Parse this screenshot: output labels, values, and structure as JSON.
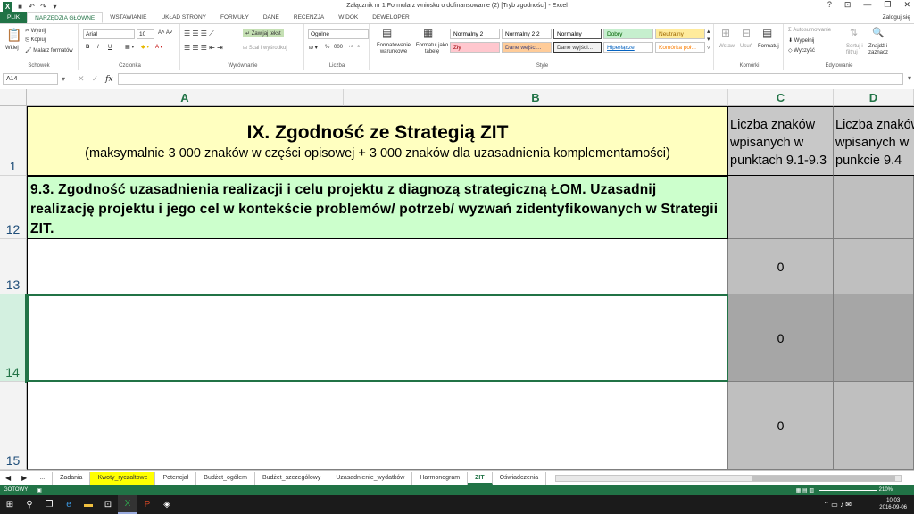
{
  "titlebar": {
    "title": "Załącznik nr 1  Formularz wniosku o dofinansowanie (2)  [Tryb zgodności] - Excel",
    "help": "?",
    "minimize": "—",
    "restore": "❐",
    "close": "✕"
  },
  "ribbon_tabs": [
    "PLIK",
    "NARZĘDZIA GŁÓWNE",
    "WSTAWIANIE",
    "UKŁAD STRONY",
    "FORMUŁY",
    "DANE",
    "RECENZJA",
    "WIDOK",
    "DEWELOPER"
  ],
  "signin": "Zaloguj się",
  "ribbon": {
    "clipboard": {
      "paste": "Wklej",
      "cut": "Wytnij",
      "copy": "Kopiuj",
      "painter": "Malarz formatów",
      "label": "Schowek"
    },
    "font": {
      "name": "Arial",
      "size": "10",
      "bold": "B",
      "italic": "I",
      "underline": "U",
      "label": "Czcionka"
    },
    "alignment": {
      "wrap": "Zawijaj tekst",
      "merge": "Scal i wyśrodkuj",
      "label": "Wyrównanie"
    },
    "number": {
      "format": "Ogólne",
      "percent": "%",
      "thousands": "000",
      "label": "Liczba"
    },
    "styles": {
      "cond_format": "Formatowanie warunkowe",
      "as_table": "Formatuj jako tabelę",
      "cells": [
        {
          "text": "Normalny 2",
          "bg": "#ffffff",
          "color": "#000000"
        },
        {
          "text": "Normalny 2 2",
          "bg": "#ffffff",
          "color": "#000000"
        },
        {
          "text": "Normalny",
          "bg": "#ffffff",
          "color": "#000000"
        },
        {
          "text": "Dobry",
          "bg": "#c6efce",
          "color": "#006100"
        },
        {
          "text": "Neutralny",
          "bg": "#ffeb9c",
          "color": "#9c6500"
        },
        {
          "text": "Zły",
          "bg": "#ffc7ce",
          "color": "#9c0006"
        },
        {
          "text": "Dane wejści...",
          "bg": "#ffcc99",
          "color": "#3f3f76"
        },
        {
          "text": "Dane wyjści...",
          "bg": "#f2f2f2",
          "color": "#3f3f3f"
        },
        {
          "text": "Hiperłącze",
          "bg": "#ffffff",
          "color": "#0563c1"
        },
        {
          "text": "Komórka poł...",
          "bg": "#ffffff",
          "color": "#fa7d00"
        }
      ],
      "label": "Style"
    },
    "cells_group": {
      "insert": "Wstaw",
      "delete": "Usuń",
      "format": "Formatuj",
      "label": "Komórki"
    },
    "editing": {
      "autosum": "Autosumowanie",
      "fill": "Wypełnij",
      "clear": "Wyczyść",
      "sort": "Sortuj i filtruj",
      "find": "Znajdź i zaznacz",
      "label": "Edytowanie"
    }
  },
  "formulabar": {
    "namebox": "A14",
    "fx": "fx",
    "value": ""
  },
  "sheet": {
    "columns": [
      "A",
      "B",
      "C",
      "D"
    ],
    "rows": [
      "1",
      "12",
      "13",
      "14",
      "15"
    ],
    "r1_title": "IX. Zgodność ze Strategią ZIT",
    "r1_subtitle": "(maksymalnie 3 000 znaków w części opisowej + 3 000 znaków dla uzasadnienia komplementarności)",
    "r1_c": "Liczba znaków wpisanych w punktach 9.1-9.3",
    "r1_d": "Liczba znaków wpisanych w punkcie 9.4",
    "r12_text": "9.3. Zgodność uzasadnienia realizacji i celu projektu z diagnozą strategiczną ŁOM. Uzasadnij realizację projektu i jego cel w kontekście problemów/ potrzeb/ wyzwań zidentyfikowanych w Strategii ZIT.",
    "r13_c": "0",
    "r14_c": "0",
    "r15_c": "0"
  },
  "sheet_tabs": [
    "...",
    "Zadania",
    "Kwoty_ryczałtowe",
    "Potencjał",
    "Budżet_ogółem",
    "Budżet_szczegółowy",
    "Uzasadnienie_wydatków",
    "Harmonogram",
    "ZIT",
    "Oświadczenia"
  ],
  "status": {
    "ready": "GOTOWY",
    "zoom": "210%"
  },
  "taskbar": {
    "time": "10:03",
    "date": "2016-09-06"
  }
}
